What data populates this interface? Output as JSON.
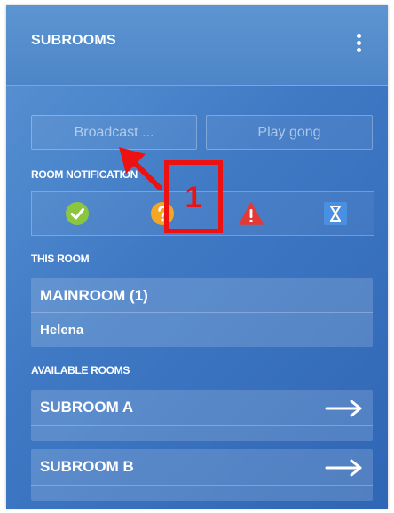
{
  "panel": {
    "title": "SUBROOMS",
    "menu_icon": "more-vertical-icon"
  },
  "actions": {
    "broadcast_label": "Broadcast ...",
    "play_gong_label": "Play gong"
  },
  "notifications": {
    "label": "ROOM NOTIFICATION",
    "icons": [
      "check-circle-icon",
      "question-circle-icon",
      "warning-triangle-icon",
      "hourglass-icon"
    ],
    "colors": {
      "check": "#8cc63f",
      "question": "#f5a623",
      "warning": "#e53935",
      "hourglass": "#4a90e2"
    }
  },
  "this_room": {
    "label": "THIS ROOM",
    "name": "MAINROOM (1)",
    "members": [
      "Helena"
    ]
  },
  "available_rooms": {
    "label": "AVAILABLE ROOMS",
    "rooms": [
      {
        "name": "SUBROOM A",
        "icon": "arrow-right-icon"
      },
      {
        "name": "SUBROOM B",
        "icon": "arrow-right-icon"
      }
    ]
  },
  "annotation": {
    "number": "1",
    "color": "#ee1111"
  }
}
